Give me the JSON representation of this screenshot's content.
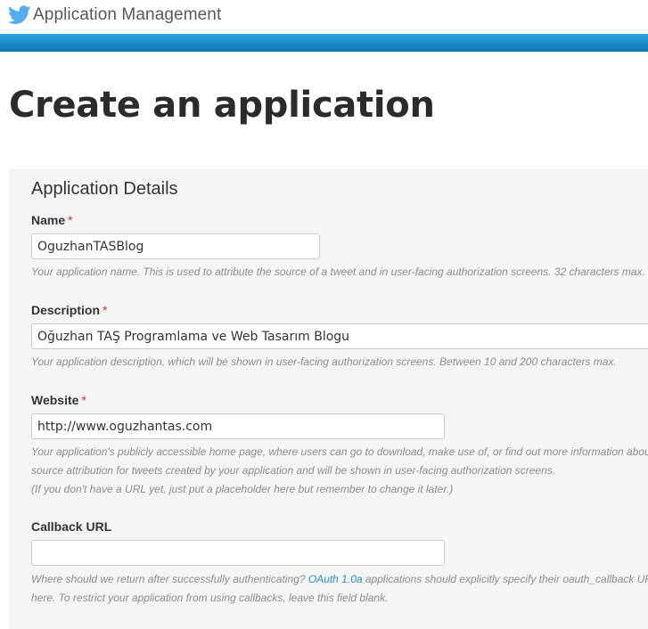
{
  "header": {
    "title": "Application Management",
    "logo_icon": "twitter-bird-icon",
    "brand_color": "#55acee",
    "band_color": "#1987c6"
  },
  "page": {
    "title": "Create an application"
  },
  "details": {
    "section_title": "Application Details",
    "required_mark": "*",
    "name": {
      "label": "Name",
      "value": "OguzhanTASBlog",
      "help": "Your application name. This is used to attribute the source of a tweet and in user-facing authorization screens. 32 characters max."
    },
    "description": {
      "label": "Description",
      "value": "Oğuzhan TAŞ Programlama ve Web Tasarım Blogu",
      "help": "Your application description, which will be shown in user-facing authorization screens. Between 10 and 200 characters max."
    },
    "website": {
      "label": "Website",
      "value": "http://www.oguzhantas.com",
      "help_line1": "Your application's publicly accessible home page, where users can go to download, make use of, or find out more information about your application. This fully-qualified URL is used in the",
      "help_line2": "source attribution for tweets created by your application and will be shown in user-facing authorization screens.",
      "help_line3": "(If you don't have a URL yet, just put a placeholder here but remember to change it later.)"
    },
    "callback": {
      "label": "Callback URL",
      "value": "",
      "help_line1_pre": "Where should we return after successfully authenticating? ",
      "help_link": "OAuth 1.0a",
      "help_line1_post": " applications should explicitly specify their oauth_callback URL on the request token step, regardless of the value given",
      "help_line2": "here. To restrict your application from using callbacks, leave this field blank."
    }
  }
}
